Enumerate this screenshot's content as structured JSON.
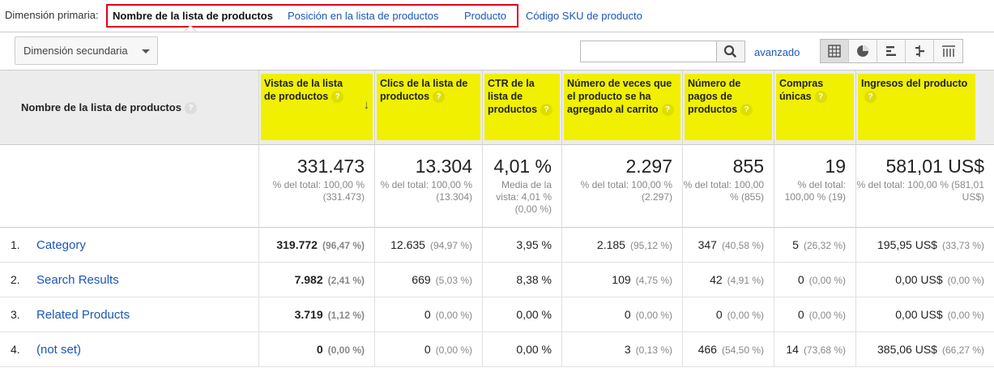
{
  "primary_dimension": {
    "label": "Dimensión primaria:",
    "options": [
      {
        "label": "Nombre de la lista de productos",
        "active": true
      },
      {
        "label": "Posición en la lista de productos",
        "active": false
      },
      {
        "label": "Producto",
        "active": false
      },
      {
        "label": "Código SKU de producto",
        "active": false
      }
    ]
  },
  "toolbar": {
    "secondary_dimension": "Dimensión secundaria",
    "search_value": "",
    "advanced_label": "avanzado",
    "view_icons": [
      "table-view-icon",
      "pie-view-icon",
      "performance-view-icon",
      "comparison-view-icon",
      "pivot-view-icon"
    ],
    "active_view": "table-view-icon"
  },
  "table": {
    "first_column": "Nombre de la lista de productos",
    "columns": [
      {
        "label": "Vistas de la lista de productos"
      },
      {
        "label": "Clics de la lista de productos"
      },
      {
        "label": "CTR de la lista de productos"
      },
      {
        "label": "Número de veces que el producto se ha agregado al carrito"
      },
      {
        "label": "Número de pagos de productos"
      },
      {
        "label": "Compras únicas"
      },
      {
        "label": "Ingresos del producto"
      }
    ],
    "totals": [
      {
        "value": "331.473",
        "sub": "% del total: 100,00 % (331.473)"
      },
      {
        "value": "13.304",
        "sub": "% del total: 100,00 % (13.304)"
      },
      {
        "value": "4,01 %",
        "sub": "Media de la vista: 4,01 % (0,00 %)"
      },
      {
        "value": "2.297",
        "sub": "% del total: 100,00 % (2.297)"
      },
      {
        "value": "855",
        "sub": "% del total: 100,00 % (855)"
      },
      {
        "value": "19",
        "sub": "% del total: 100,00 % (19)"
      },
      {
        "value": "581,01 US$",
        "sub": "% del total: 100,00 % (581,01 US$)"
      }
    ],
    "rows": [
      {
        "num": "1.",
        "name": "Category",
        "cells": [
          {
            "v": "319.772",
            "p": "(96,47 %)"
          },
          {
            "v": "12.635",
            "p": "(94,97 %)"
          },
          {
            "v": "3,95 %",
            "p": ""
          },
          {
            "v": "2.185",
            "p": "(95,12 %)"
          },
          {
            "v": "347",
            "p": "(40,58 %)"
          },
          {
            "v": "5",
            "p": "(26,32 %)"
          },
          {
            "v": "195,95 US$",
            "p": "(33,73 %)"
          }
        ]
      },
      {
        "num": "2.",
        "name": "Search Results",
        "cells": [
          {
            "v": "7.982",
            "p": "(2,41 %)"
          },
          {
            "v": "669",
            "p": "(5,03 %)"
          },
          {
            "v": "8,38 %",
            "p": ""
          },
          {
            "v": "109",
            "p": "(4,75 %)"
          },
          {
            "v": "42",
            "p": "(4,91 %)"
          },
          {
            "v": "0",
            "p": "(0,00 %)"
          },
          {
            "v": "0,00 US$",
            "p": "(0,00 %)"
          }
        ]
      },
      {
        "num": "3.",
        "name": "Related Products",
        "cells": [
          {
            "v": "3.719",
            "p": "(1,12 %)"
          },
          {
            "v": "0",
            "p": "(0,00 %)"
          },
          {
            "v": "0,00 %",
            "p": ""
          },
          {
            "v": "0",
            "p": "(0,00 %)"
          },
          {
            "v": "0",
            "p": "(0,00 %)"
          },
          {
            "v": "0",
            "p": "(0,00 %)"
          },
          {
            "v": "0,00 US$",
            "p": "(0,00 %)"
          }
        ]
      },
      {
        "num": "4.",
        "name": "(not set)",
        "cells": [
          {
            "v": "0",
            "p": "(0,00 %)"
          },
          {
            "v": "0",
            "p": "(0,00 %)"
          },
          {
            "v": "0,00 %",
            "p": ""
          },
          {
            "v": "3",
            "p": "(0,13 %)"
          },
          {
            "v": "466",
            "p": "(54,50 %)"
          },
          {
            "v": "14",
            "p": "(73,68 %)"
          },
          {
            "v": "385,06 US$",
            "p": "(66,27 %)"
          }
        ]
      }
    ]
  },
  "colors": {
    "highlight": "#f0f000",
    "link": "#1a56b8",
    "callout_border": "#e0001b"
  }
}
